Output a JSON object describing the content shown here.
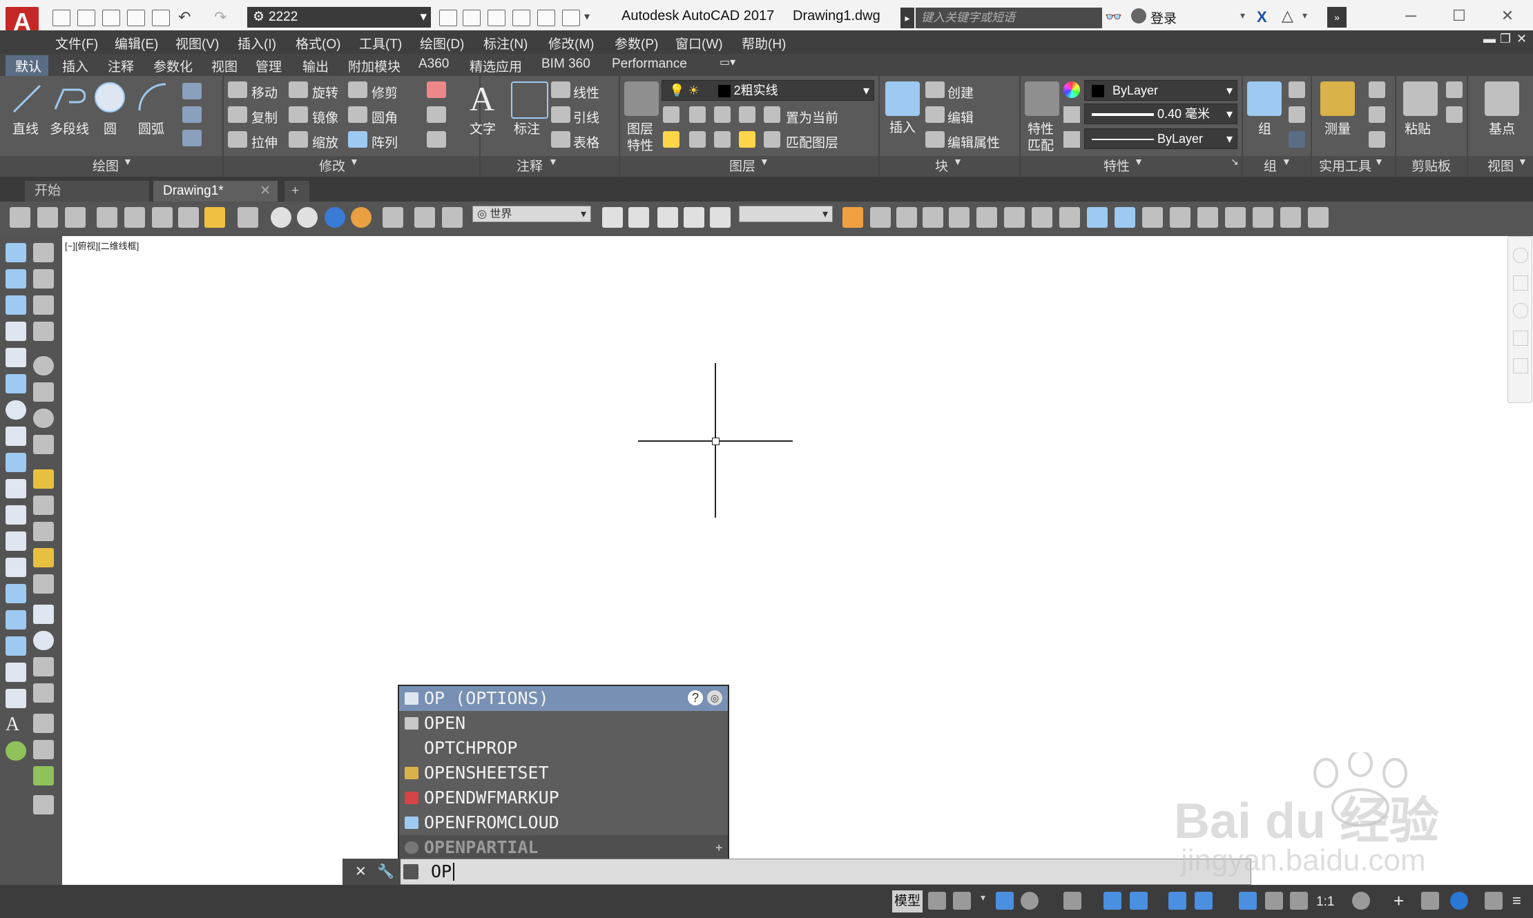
{
  "titlebar": {
    "app_logo": "A",
    "workspace": "2222",
    "app_name": "Autodesk AutoCAD 2017",
    "file_name": "Drawing1.dwg",
    "search_placeholder": "键入关键字或短语",
    "signin": "登录"
  },
  "menubar": {
    "items": [
      "文件(F)",
      "编辑(E)",
      "视图(V)",
      "插入(I)",
      "格式(O)",
      "工具(T)",
      "绘图(D)",
      "标注(N)",
      "修改(M)",
      "参数(P)",
      "窗口(W)",
      "帮助(H)"
    ]
  },
  "ribbon_tabs": {
    "items": [
      "默认",
      "插入",
      "注释",
      "参数化",
      "视图",
      "管理",
      "输出",
      "附加模块",
      "A360",
      "精选应用",
      "BIM 360",
      "Performance"
    ],
    "active": "默认"
  },
  "ribbon": {
    "draw": {
      "line": "直线",
      "polyline": "多段线",
      "circle": "圆",
      "arc": "圆弧",
      "title": "绘图"
    },
    "modify": {
      "move": "移动",
      "rotate": "旋转",
      "trim": "修剪",
      "copy": "复制",
      "mirror": "镜像",
      "fillet": "圆角",
      "stretch": "拉伸",
      "scale": "缩放",
      "array": "阵列",
      "title": "修改"
    },
    "annotation": {
      "text": "文字",
      "dim": "标注",
      "linear": "线性",
      "leader": "引线",
      "table": "表格",
      "title": "注释"
    },
    "layers": {
      "layer_props_1": "图层",
      "layer_props_2": "特性",
      "current_layer": "2粗实线",
      "set_current": "置为当前",
      "match_layer": "匹配图层",
      "title": "图层"
    },
    "block": {
      "insert": "插入",
      "create": "创建",
      "edit": "编辑",
      "edit_attr": "编辑属性",
      "title": "块"
    },
    "properties": {
      "match_1": "特性",
      "match_2": "匹配",
      "color": "ByLayer",
      "lineweight": "0.40 毫米",
      "linetype": "ByLayer",
      "title": "特性"
    },
    "groups": {
      "group": "组",
      "title": "组"
    },
    "utilities": {
      "measure": "测量",
      "title": "实用工具"
    },
    "clipboard": {
      "paste": "粘贴",
      "title": "剪贴板"
    },
    "view": {
      "base": "基点",
      "title": "视图"
    }
  },
  "doc_tabs": {
    "start": "开始",
    "drawing": "Drawing1*",
    "add": "+"
  },
  "toolbar2": {
    "ucs_select": "世界",
    "layer_select": ""
  },
  "canvas": {
    "view_label": "[−][俯视][二维线框]"
  },
  "autocomplete": {
    "items": [
      "OP (OPTIONS)",
      "OPEN",
      "OPTCHPROP",
      "OPENSHEETSET",
      "OPENDWFMARKUP",
      "OPENFROMCLOUD",
      "OPENPARTIAL"
    ],
    "selected_index": 0
  },
  "command_line": {
    "input": "OP"
  },
  "statusbar": {
    "model": "模型",
    "scale": "1:1"
  },
  "watermark": {
    "brand": "Bai du 经验",
    "url": "jingyan.baidu.com"
  },
  "colors": {
    "accent_selected": "#7890b4",
    "app_red": "#c62828",
    "ribbon_bg": "#5a5a5a"
  }
}
